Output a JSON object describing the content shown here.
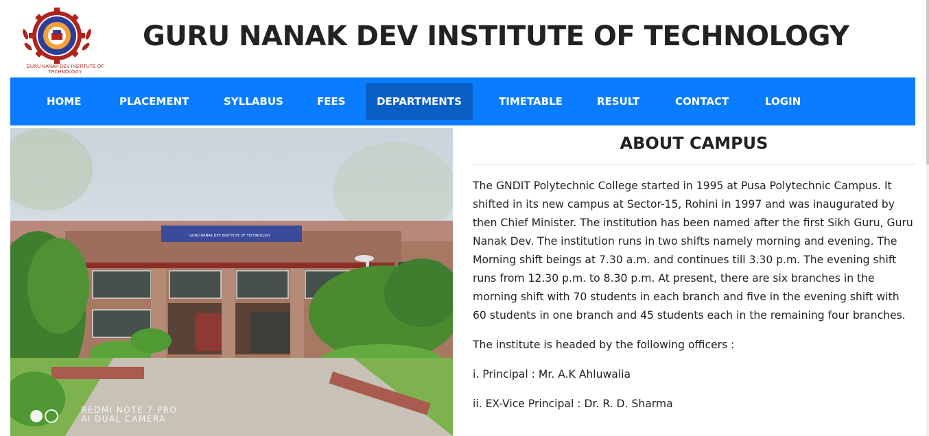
{
  "header": {
    "title": "GURU NANAK DEV INSTITUTE OF TECHNOLOGY",
    "logo_caption": "GURU NANAK DEV INSTITUTE OF TECHNOLOGY"
  },
  "nav": {
    "items": [
      {
        "label": "HOME"
      },
      {
        "label": "PLACEMENT"
      },
      {
        "label": "SYLLABUS"
      },
      {
        "label": "FEES"
      },
      {
        "label": "DEPARTMENTS"
      },
      {
        "label": "TIMETABLE"
      },
      {
        "label": "RESULT"
      },
      {
        "label": "CONTACT"
      },
      {
        "label": "LOGIN"
      }
    ],
    "active": "DEPARTMENTS"
  },
  "photo": {
    "watermark_line1": "REDMI NOTE 7 PRO",
    "watermark_line2": "AI DUAL CAMERA",
    "sign_text": "GURU NANAK DEV INSTITUTE OF TECHNOLOGY"
  },
  "about": {
    "title": "ABOUT CAMPUS",
    "paragraph": "The GNDIT Polytechnic College started in 1995 at Pusa Polytechnic Campus. It shifted in its new campus at Sector-15, Rohini in 1997 and was inaugurated by then Chief Minister. The institution has been named after the first Sikh Guru, Guru Nanak Dev. The institution runs in two shifts namely morning and evening. The Morning shift beings at 7.30 a.m. and continues till 3.30 p.m. The evening shift runs from 12.30 p.m. to 8.30 p.m. At present, there are six branches in the morning shift with 70 students in each branch and five in the evening shift with 60 students in one branch and 45 students each in the remaining four branches.",
    "officers_intro": "The institute is headed by the following officers :",
    "officers": [
      "i. Principal : Mr. A.K Ahluwalia",
      "ii. EX-Vice Principal : Dr. R. D. Sharma"
    ]
  },
  "colors": {
    "nav_bg": "#0a7cff",
    "nav_active": "#0a5fc6",
    "logo_red": "#b0241b",
    "logo_blue": "#2c3e99"
  }
}
